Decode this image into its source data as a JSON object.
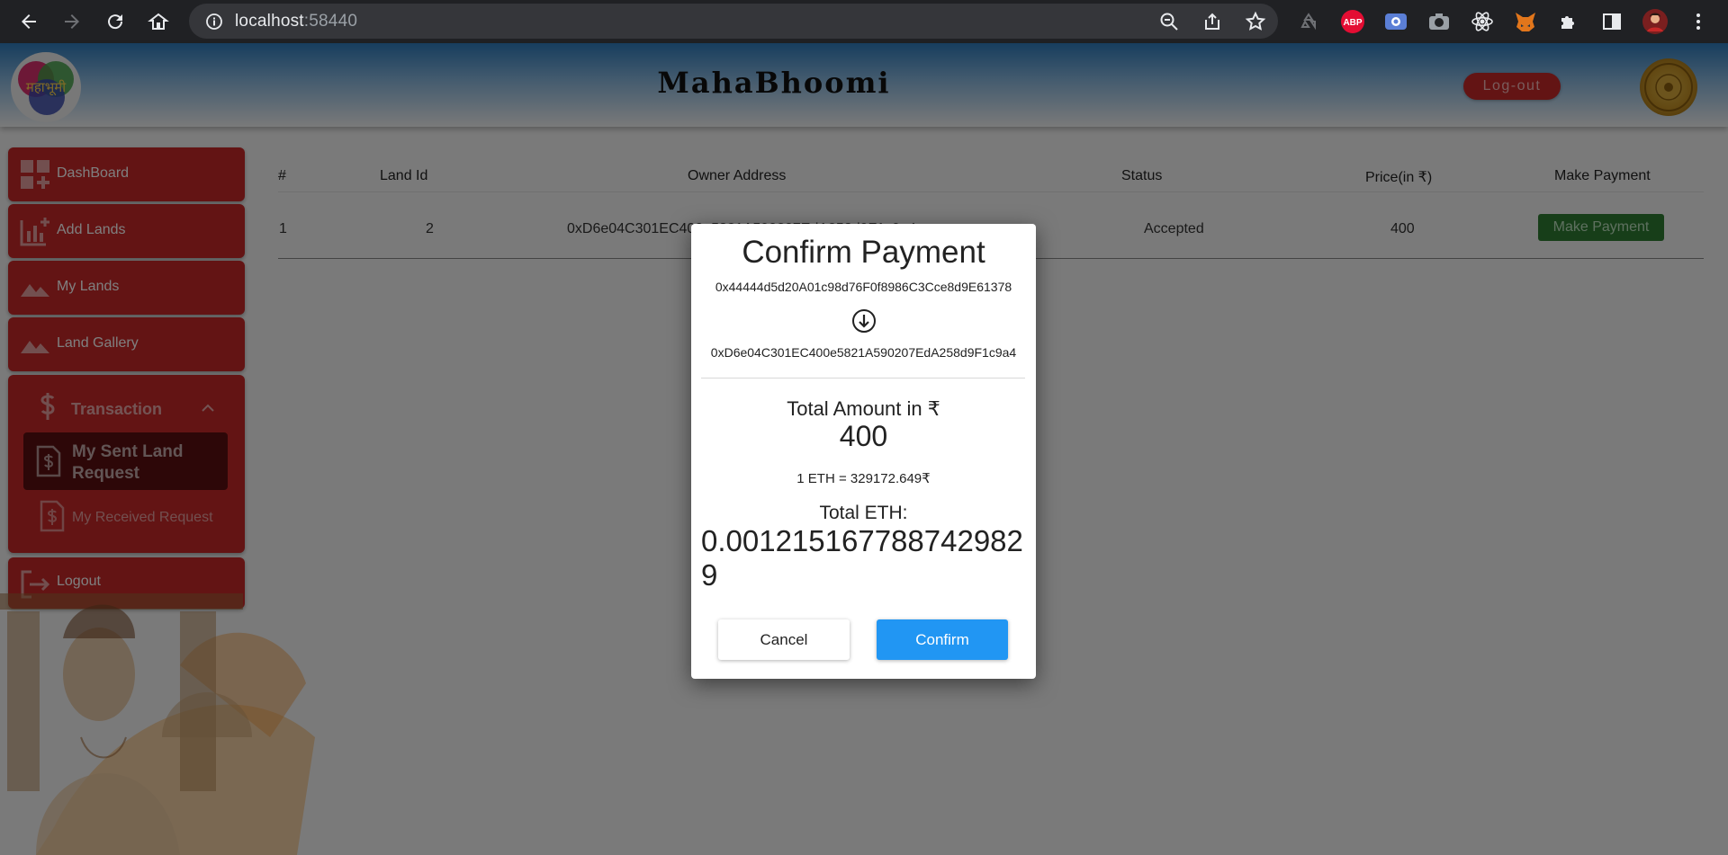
{
  "browser": {
    "url_host": "localhost",
    "url_port": ":58440",
    "icons": [
      "back-icon",
      "forward-icon",
      "reload-icon",
      "home-icon",
      "info-icon",
      "zoom-icon",
      "share-icon",
      "star-icon",
      "recycle-icon",
      "abp-icon",
      "screen-icon",
      "camera-icon",
      "react-icon",
      "fox-icon",
      "puzzle-icon",
      "sidepanel-icon",
      "profile-avatar",
      "menu-icon"
    ],
    "abp_label": "ABP"
  },
  "header": {
    "title": "MahaBhoomi",
    "logout_label": "Log-out",
    "logo_text": "महाभूमी"
  },
  "sidebar": {
    "items": [
      {
        "label": "DashBoard",
        "icon": "dashboard-icon"
      },
      {
        "label": "Add Lands",
        "icon": "chart-add-icon"
      },
      {
        "label": "My Lands",
        "icon": "landscape-icon"
      },
      {
        "label": "Land Gallery",
        "icon": "landscape-icon"
      }
    ],
    "transaction": {
      "label": "Transaction",
      "children": [
        {
          "label": "My Sent Land Request",
          "active": true
        },
        {
          "label": "My Received Request",
          "active": false
        }
      ]
    },
    "logout_label": "Logout"
  },
  "table": {
    "headers": [
      "#",
      "Land Id",
      "Owner Address",
      "Status",
      "Price(in ₹)",
      "Make Payment"
    ],
    "row": {
      "index": "1",
      "land_id": "2",
      "owner": "0xD6e04C301EC400e5821A590207EdA258d9F1c9a4",
      "status": "Accepted",
      "price": "400",
      "button": "Make Payment"
    }
  },
  "modal": {
    "title": "Confirm Payment",
    "from_address": "0x44444d5d20A01c98d76F0f8986C3Cce8d9E61378",
    "to_address": "0xD6e04C301EC400e5821A590207EdA258d9F1c9a4",
    "amount_label": "Total Amount in ₹",
    "amount": "400",
    "rate": "1 ETH = 329172.649₹",
    "eth_label": "Total ETH:",
    "eth_value": "0.0012151677887429829",
    "cancel_label": "Cancel",
    "confirm_label": "Confirm"
  },
  "colors": {
    "sidebar_red": "#c62828",
    "confirm_blue": "#2196f3",
    "pay_green": "#2e7d32"
  }
}
